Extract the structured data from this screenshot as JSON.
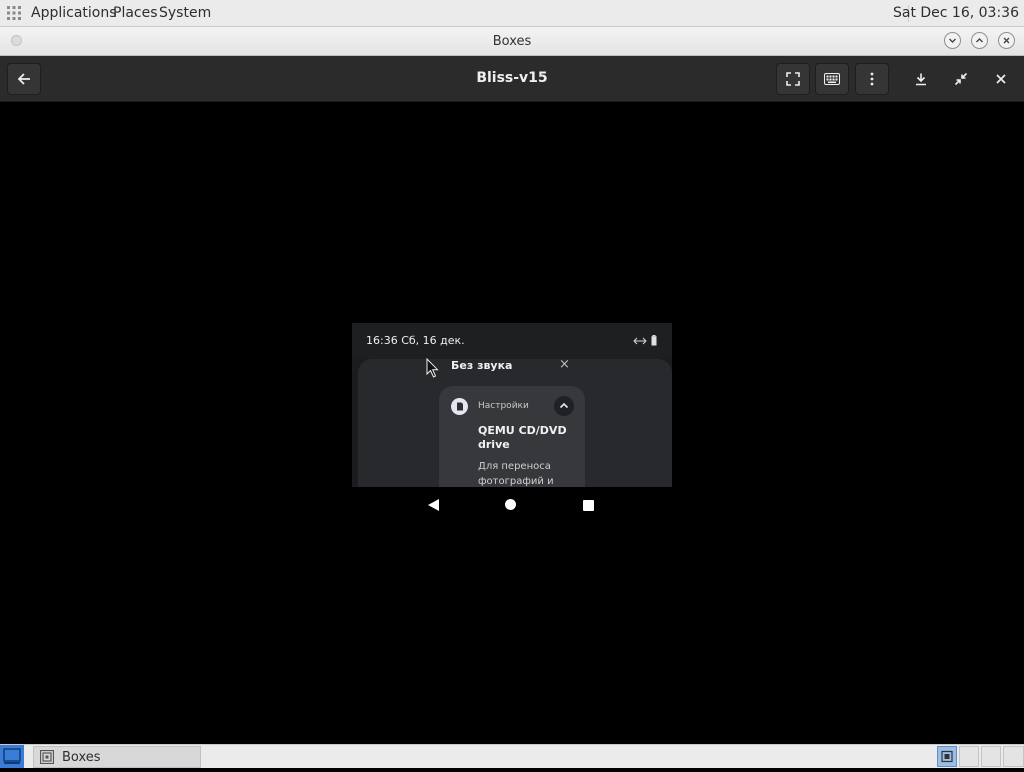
{
  "top_panel": {
    "menus": [
      "Applications",
      "Places",
      "System"
    ],
    "clock": "Sat Dec 16, 03:36"
  },
  "window": {
    "title": "Boxes"
  },
  "header_bar": {
    "title": "Bliss-v15"
  },
  "android": {
    "status_time": "16:36  Сб, 16 дек.",
    "mute_label": "Без звука",
    "mute_close": "×",
    "notification": {
      "app_name": "Настройки",
      "title": "QEMU CD/DVD drive",
      "body": "Для переноса фотографий и"
    }
  },
  "taskbar": {
    "task_label": "Boxes"
  },
  "icons": {
    "top_panel": [
      "apps-grid-icon"
    ],
    "title_bar": [
      "window-menu-icon",
      "minimize-icon",
      "maximize-icon",
      "close-icon"
    ],
    "header_bar": [
      "back-arrow-icon",
      "fullscreen-icon",
      "keyboard-icon",
      "more-options-icon",
      "download-icon",
      "unfullscreen-icon",
      "close-icon"
    ],
    "android": [
      "wifi-arrows-icon",
      "battery-icon",
      "sd-card-icon",
      "chevron-up-icon",
      "nav-back-icon",
      "nav-home-icon",
      "nav-recents-icon"
    ]
  },
  "colors": {
    "panel_bg": "#ebebeb",
    "header_bg": "#2b2b2b",
    "display_bg": "#000000",
    "notification_card": "#36383c",
    "taskbar_accent": "#3a7cd6"
  }
}
